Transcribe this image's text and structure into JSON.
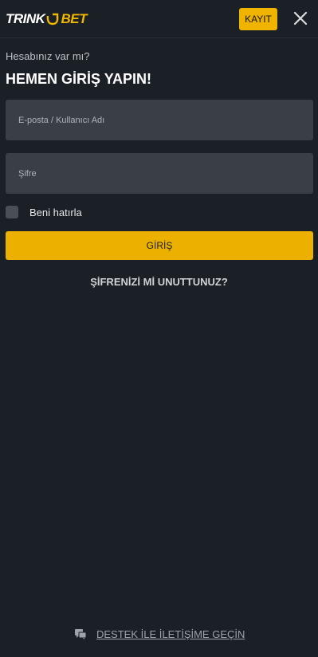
{
  "header": {
    "logo_part1": "TRINK",
    "logo_part2": "BET",
    "register_label": "KAYIT",
    "close_icon": "close-icon"
  },
  "login": {
    "subtitle": "Hesabınız var mı?",
    "title": "HEMEN GİRİŞ YAPIN!",
    "username_placeholder": "E-posta / Kullanıcı Adı",
    "username_value": "",
    "password_placeholder": "Şifre",
    "password_value": "",
    "remember_label": "Beni hatırla",
    "remember_checked": false,
    "submit_label": "GİRİŞ",
    "forgot_label": "ŞİFRENİZİ Mİ UNUTTUNUZ?"
  },
  "footer": {
    "support_label": "DESTEK İLE İLETİŞİME GEÇİN",
    "support_icon": "chat-icon"
  },
  "colors": {
    "background": "#1b1f26",
    "accent": "#ebb000",
    "field": "#3a3f47"
  }
}
